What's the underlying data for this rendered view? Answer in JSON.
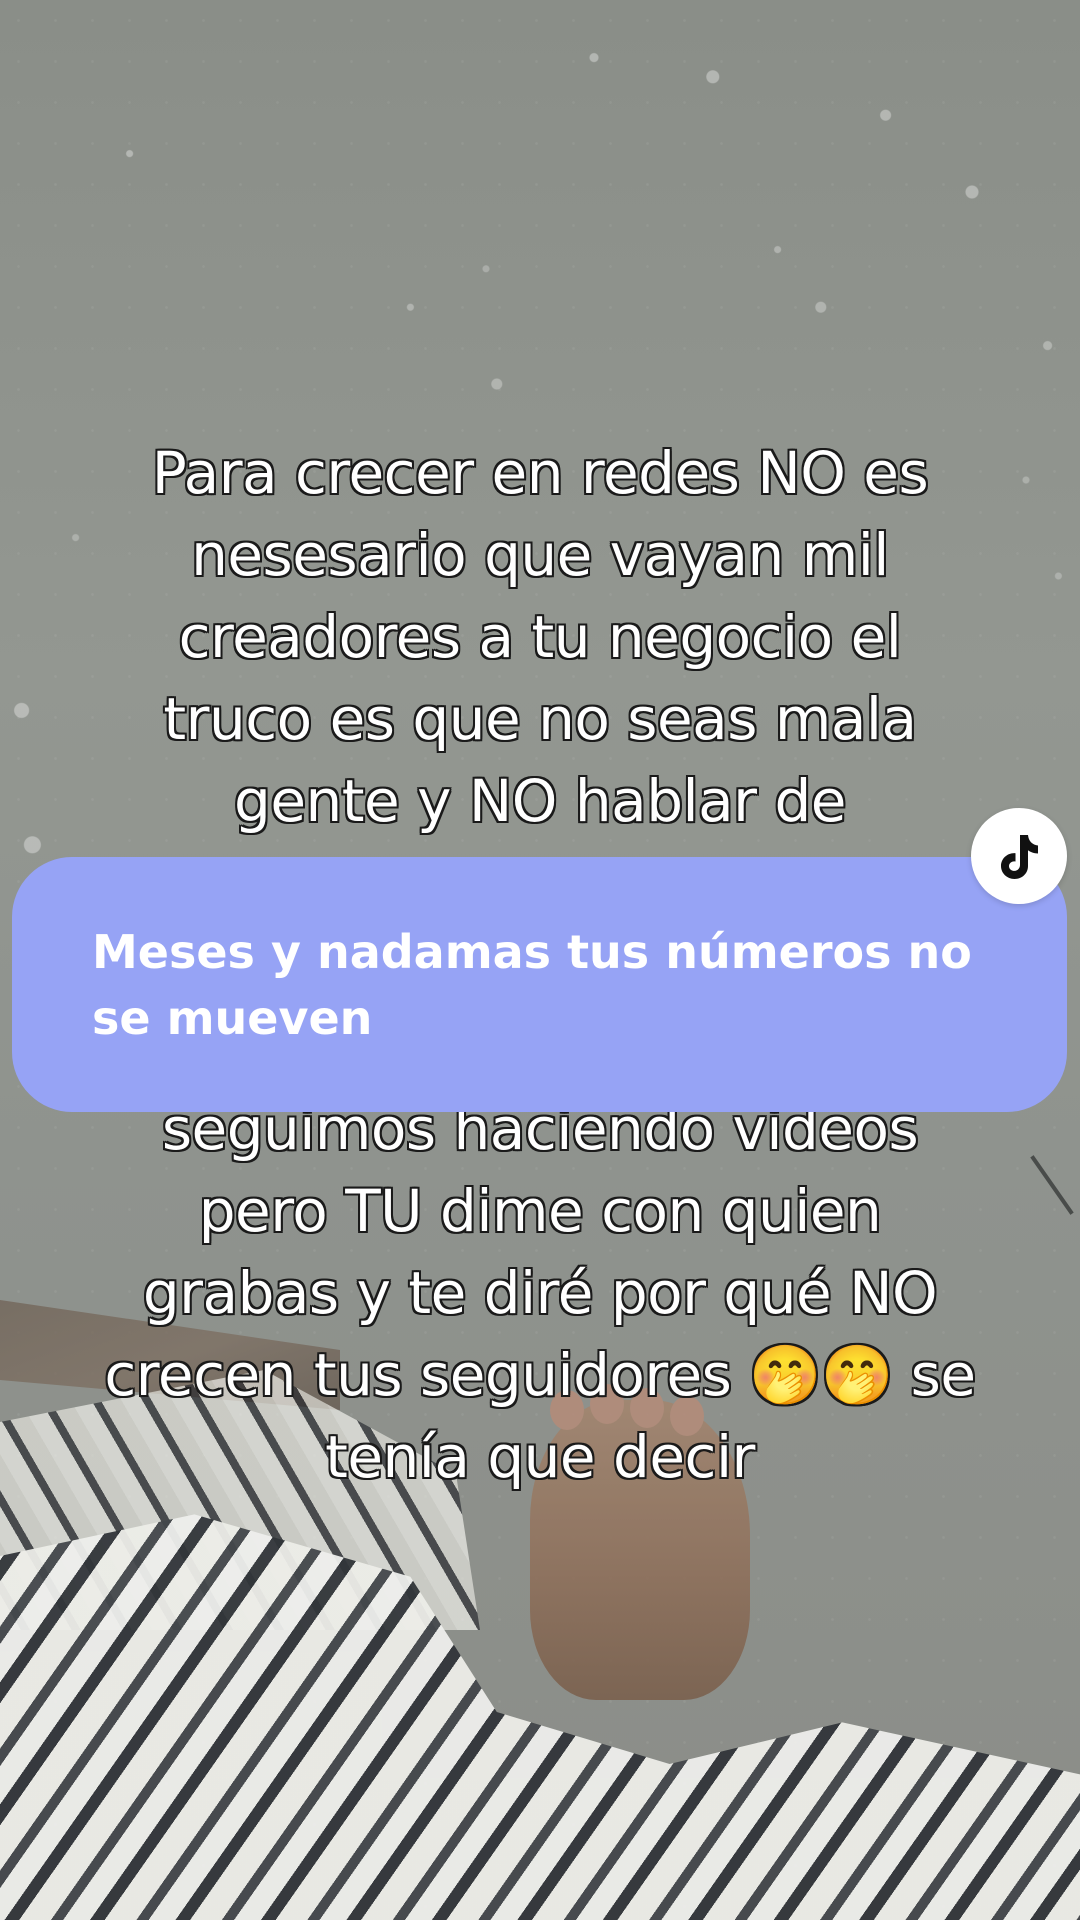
{
  "background": {
    "scene": "beach-sand-with-feet-and-patterned-fabric"
  },
  "caption_top": {
    "lines": [
      "Para crecer en redes NO es",
      "nesesario que vayan mil",
      "creadores a tu negocio el",
      "truco es que no seas mala",
      "gente y NO hablar de"
    ]
  },
  "caption_bottom": {
    "lines": [
      "seguimos haciendo videos",
      "pero TU dime con quien",
      "grabas y te diré por qué NO",
      "crecen tus seguidores 🤭🤭 se",
      "tenía que decir"
    ]
  },
  "reply_bubble": {
    "text_line_1": "Meses y nadamas tus números no",
    "text_line_2": "se mueven",
    "color": "#96a3f5"
  },
  "badge": {
    "icon": "tiktok-logo-icon"
  }
}
